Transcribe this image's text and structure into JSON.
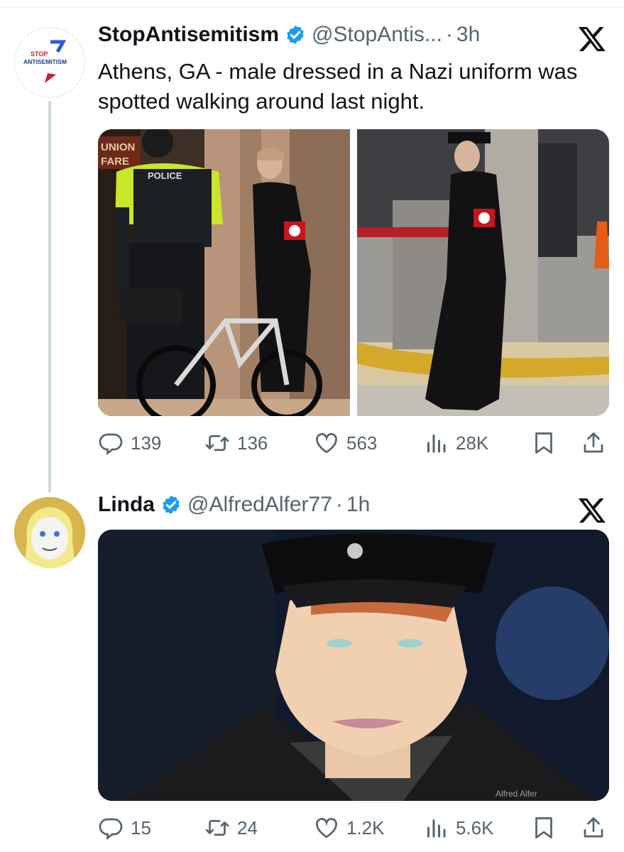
{
  "tweets": [
    {
      "author_name": "StopAntisemitism",
      "handle": "@StopAntis...",
      "separator": "·",
      "time": "3h",
      "avatar_text_line1": "STOP",
      "avatar_text_line2": "ANTISEMITISM",
      "text": "Athens, GA - male dressed in a Nazi uniform was spotted walking around last night.",
      "media_labels": [
        "UNION",
        "FARE",
        "POLICE"
      ],
      "stats": {
        "replies": "139",
        "reposts": "136",
        "likes": "563",
        "views": "28K"
      }
    },
    {
      "author_name": "Linda",
      "handle": "@AlfredAlfer77",
      "separator": "·",
      "time": "1h",
      "watermark": "Alfred Alfer",
      "stats": {
        "replies": "15",
        "reposts": "24",
        "likes": "1.2K",
        "views": "5.6K"
      }
    }
  ],
  "colors": {
    "text": "#0f1419",
    "secondary": "#536471",
    "verified": "#1d9bf0",
    "thread_line": "#cfd9de"
  },
  "icons": [
    "verified-badge-icon",
    "x-logo-icon",
    "reply-icon",
    "repost-icon",
    "like-icon",
    "views-icon",
    "bookmark-icon",
    "share-icon"
  ]
}
